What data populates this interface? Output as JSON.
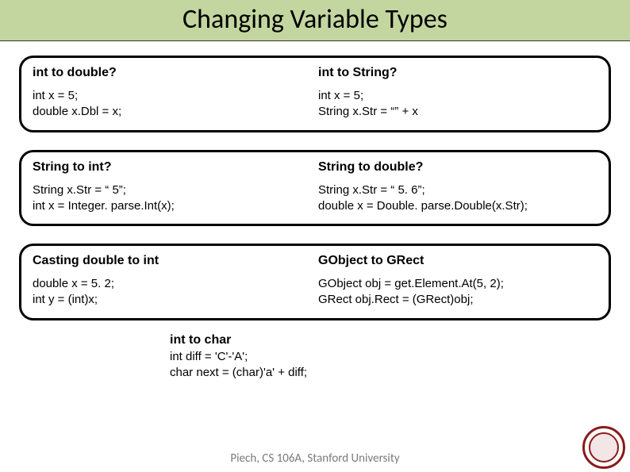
{
  "title": "Changing Variable Types",
  "row1": {
    "left": {
      "header": "int to double?",
      "line1": "int x = 5;",
      "line2": "double x.Dbl = x;"
    },
    "right": {
      "header": "int to String?",
      "line1": "int x = 5;",
      "line2": "String x.Str = “” + x"
    }
  },
  "row2": {
    "left": {
      "header": "String to int?",
      "line1": "String x.Str = “ 5”;",
      "line2": "int x = Integer. parse.Int(x);"
    },
    "right": {
      "header": "String to double?",
      "line1": "String x.Str = “ 5. 6”;",
      "line2": "double x = Double. parse.Double(x.Str);"
    }
  },
  "row3": {
    "left": {
      "header": "Casting double to int",
      "line1": "double x = 5. 2;",
      "line2": "int y = (int)x;"
    },
    "right": {
      "header": "GObject to GRect",
      "line1": "GObject obj = get.Element.At(5, 2);",
      "line2": "GRect obj.Rect = (GRect)obj;"
    }
  },
  "bottom": {
    "header": "int to char",
    "line1": "int diff = 'C'-'A';",
    "line2": "char next = (char)'a' + diff;"
  },
  "footer": "Piech, CS 106A, Stanford University"
}
